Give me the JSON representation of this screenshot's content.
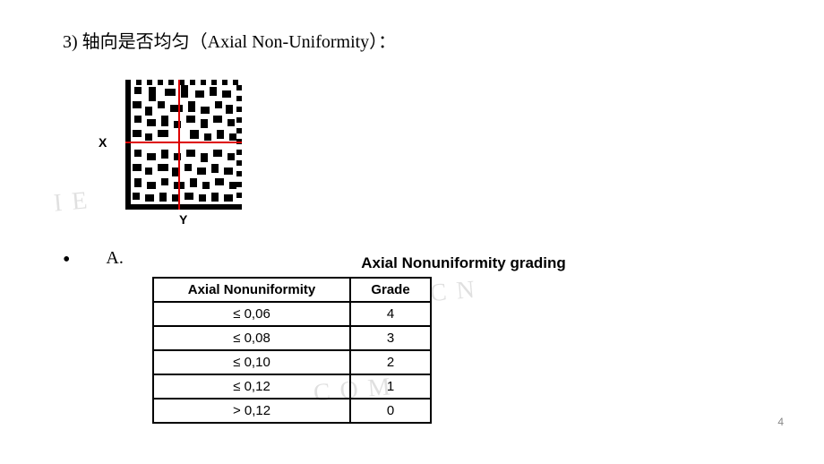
{
  "heading": "3) 轴向是否均匀（Axial Non-Uniformity）：",
  "diagram": {
    "x_label": "X",
    "y_label": "Y"
  },
  "bullet_a": "A.",
  "table_title": "Axial Nonuniformity grading",
  "table": {
    "header_an": "Axial Nonuniformity",
    "header_grade": "Grade",
    "rows": [
      {
        "an": "≤ 0,06",
        "grade": "4"
      },
      {
        "an": "≤ 0,08",
        "grade": "3"
      },
      {
        "an": "≤ 0,10",
        "grade": "2"
      },
      {
        "an": "≤ 0,12",
        "grade": "1"
      },
      {
        "an": "> 0,12",
        "grade": "0"
      }
    ]
  },
  "page_number": "4",
  "watermarks": {
    "w1": "I E",
    "w2": "C O M",
    "w3": "C N"
  }
}
